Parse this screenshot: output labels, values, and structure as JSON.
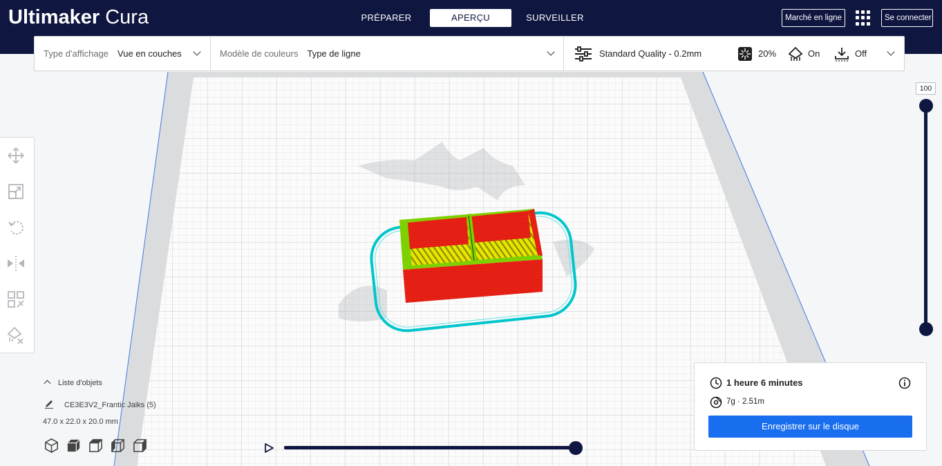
{
  "app": {
    "brand_bold": "Ultimaker",
    "brand_light": "Cura"
  },
  "header": {
    "tabs": [
      {
        "label": "PRÉPARER",
        "active": false
      },
      {
        "label": "APERÇU",
        "active": true
      },
      {
        "label": "SURVEILLER",
        "active": false
      }
    ],
    "marketplace_label": "Marché en ligne",
    "signin_label": "Se connecter",
    "apps_icon": "grid-icon"
  },
  "viewbar": {
    "view_type_label": "Type d'affichage",
    "view_type_value": "Vue en couches",
    "color_scheme_label": "Modèle de couleurs",
    "color_scheme_value": "Type de ligne",
    "profile": "Standard Quality - 0.2mm",
    "infill": "20%",
    "support": "On",
    "adhesion": "Off"
  },
  "layer_slider": {
    "value": "100"
  },
  "object_list": {
    "header": "Liste d'objets",
    "object_name": "CE3E3V2_Frantic Jaiks (5)",
    "dimensions": "47.0 x 22.0 x 20.0 mm"
  },
  "print_info": {
    "time": "1 heure 6 minutes",
    "material": "7g · 2.51m",
    "save_label": "Enregistrer sur le disque"
  },
  "playback": {
    "progress": 1.0
  },
  "colors": {
    "header_bg": "#0f1640",
    "accent": "#196ef0",
    "wall": "#e8201a",
    "infill": "#e4e400",
    "skirt": "#00d2d8"
  }
}
